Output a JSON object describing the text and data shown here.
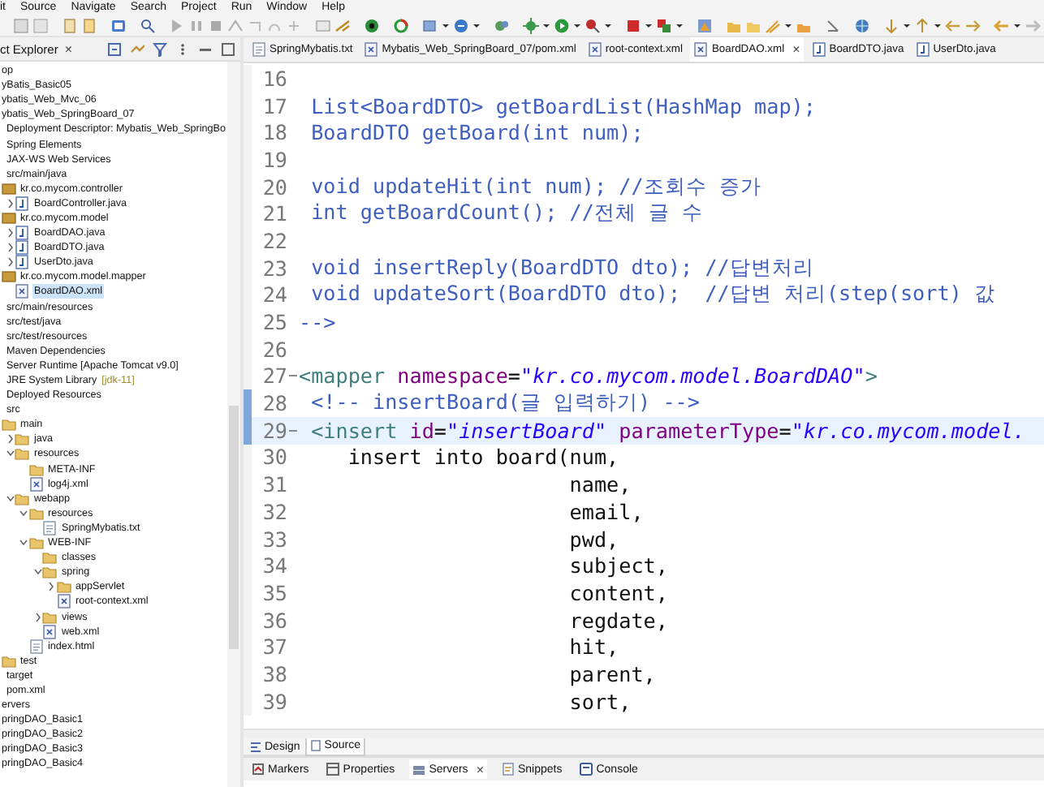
{
  "menu_bar": [
    "it",
    "Source",
    "Navigate",
    "Search",
    "Project",
    "Run",
    "Window",
    "Help"
  ],
  "explorer": {
    "title": "ct Explorer",
    "close": "×",
    "tree": [
      {
        "label": "op",
        "selected": false
      },
      {
        "label": "yBatis_Basic05",
        "selected": false
      },
      {
        "label": "ybatis_Web_Mvc_06",
        "selected": false
      },
      {
        "label": "ybatis_Web_SpringBoard_07",
        "selected": false,
        "children": [
          {
            "label": "Deployment Descriptor: Mybatis_Web_SpringBo",
            "selected": false
          },
          {
            "label": "Spring Elements",
            "selected": false
          },
          {
            "label": "JAX-WS Web Services",
            "selected": false
          },
          {
            "label": "src/main/java",
            "selected": false,
            "children": [
              {
                "label": "kr.co.mycom.controller",
                "kind": "package",
                "selected": false,
                "children": [
                  {
                    "label": "BoardController.java",
                    "kind": "java",
                    "expanded": false,
                    "selected": false
                  }
                ]
              },
              {
                "label": "kr.co.mycom.model",
                "kind": "package",
                "selected": false,
                "children": [
                  {
                    "label": "BoardDAO.java",
                    "kind": "java",
                    "expanded": false,
                    "selected": false
                  },
                  {
                    "label": "BoardDTO.java",
                    "kind": "java",
                    "expanded": false,
                    "selected": false
                  },
                  {
                    "label": "UserDto.java",
                    "kind": "java",
                    "expanded": false,
                    "selected": false
                  }
                ]
              },
              {
                "label": "kr.co.mycom.model.mapper",
                "kind": "package",
                "selected": false,
                "children": [
                  {
                    "label": "BoardDAO.xml",
                    "kind": "xml",
                    "selected": true
                  }
                ]
              }
            ]
          },
          {
            "label": "src/main/resources",
            "selected": false
          },
          {
            "label": "src/test/java",
            "selected": false
          },
          {
            "label": "src/test/resources",
            "selected": false
          },
          {
            "label": "Maven Dependencies",
            "selected": false
          },
          {
            "label": "Server Runtime [Apache Tomcat v9.0]",
            "selected": false
          },
          {
            "label": "JRE System Library",
            "decoration": "[jdk-11]",
            "selected": false
          },
          {
            "label": "Deployed Resources",
            "selected": false
          },
          {
            "label": "src",
            "selected": false,
            "children": [
              {
                "label": "main",
                "kind": "folder",
                "selected": false,
                "children": [
                  {
                    "label": "java",
                    "kind": "folder",
                    "expanded": false,
                    "selected": false
                  },
                  {
                    "label": "resources",
                    "kind": "folder",
                    "expanded": true,
                    "selected": false,
                    "children": [
                      {
                        "label": "META-INF",
                        "kind": "folder",
                        "selected": false
                      },
                      {
                        "label": "log4j.xml",
                        "kind": "xml",
                        "selected": false
                      }
                    ]
                  },
                  {
                    "label": "webapp",
                    "kind": "folder",
                    "expanded": true,
                    "selected": false,
                    "children": [
                      {
                        "label": "resources",
                        "kind": "folder",
                        "expanded": true,
                        "selected": false,
                        "children": [
                          {
                            "label": "SpringMybatis.txt",
                            "kind": "text",
                            "selected": false
                          }
                        ]
                      },
                      {
                        "label": "WEB-INF",
                        "kind": "folder",
                        "expanded": true,
                        "selected": false,
                        "children": [
                          {
                            "label": "classes",
                            "kind": "folder",
                            "selected": false
                          },
                          {
                            "label": "spring",
                            "kind": "folder",
                            "expanded": true,
                            "selected": false,
                            "children": [
                              {
                                "label": "appServlet",
                                "kind": "folder",
                                "expanded": false,
                                "selected": false
                              },
                              {
                                "label": "root-context.xml",
                                "kind": "xml",
                                "selected": false
                              }
                            ]
                          },
                          {
                            "label": "views",
                            "kind": "folder",
                            "expanded": false,
                            "selected": false
                          },
                          {
                            "label": "web.xml",
                            "kind": "xml",
                            "selected": false
                          }
                        ]
                      },
                      {
                        "label": "index.html",
                        "kind": "text",
                        "selected": false
                      }
                    ]
                  }
                ]
              },
              {
                "label": "test",
                "kind": "folder",
                "selected": false
              }
            ]
          },
          {
            "label": "target",
            "selected": false
          },
          {
            "label": "pom.xml",
            "selected": false
          }
        ]
      },
      {
        "label": "ervers",
        "selected": false
      },
      {
        "label": "pringDAO_Basic1",
        "selected": false
      },
      {
        "label": "pringDAO_Basic2",
        "selected": false
      },
      {
        "label": "pringDAO_Basic3",
        "selected": false
      },
      {
        "label": "pringDAO_Basic4",
        "selected": false
      }
    ]
  },
  "editor_tabs": [
    {
      "label": "SpringMybatis.txt",
      "kind": "text",
      "selected": false
    },
    {
      "label": "Mybatis_Web_SpringBoard_07/pom.xml",
      "kind": "xml",
      "selected": false
    },
    {
      "label": "root-context.xml",
      "kind": "xml",
      "selected": false
    },
    {
      "label": "BoardDAO.xml",
      "kind": "xml",
      "selected": true,
      "close": "×"
    },
    {
      "label": "BoardDTO.java",
      "kind": "java",
      "selected": false
    },
    {
      "label": "UserDto.java",
      "kind": "java",
      "selected": false
    }
  ],
  "editor": {
    "lines": [
      {
        "number": "16",
        "foldable": false,
        "current": false
      },
      {
        "number": "17",
        "foldable": false,
        "current": false,
        "segments": [
          {
            "text": " List<BoardDTO> getBoardList(HashMap map);",
            "kind": "comment"
          }
        ]
      },
      {
        "number": "18",
        "foldable": false,
        "current": false,
        "segments": [
          {
            "text": " BoardDTO getBoard(int num);",
            "kind": "comment"
          }
        ]
      },
      {
        "number": "19",
        "foldable": false,
        "current": false
      },
      {
        "number": "20",
        "foldable": false,
        "current": false,
        "segments": [
          {
            "text": " void updateHit(int num); //조회수 증가",
            "kind": "comment"
          }
        ]
      },
      {
        "number": "21",
        "foldable": false,
        "current": false,
        "segments": [
          {
            "text": " int getBoardCount(); //전체 글 수",
            "kind": "comment"
          }
        ]
      },
      {
        "number": "22",
        "foldable": false,
        "current": false
      },
      {
        "number": "23",
        "foldable": false,
        "current": false,
        "segments": [
          {
            "text": " void insertReply(BoardDTO dto); //답변처리",
            "kind": "comment"
          }
        ]
      },
      {
        "number": "24",
        "foldable": false,
        "current": false,
        "segments": [
          {
            "text": " void updateSort(BoardDTO dto);  //답변 처리(step(sort) 값",
            "kind": "comment"
          }
        ]
      },
      {
        "number": "25",
        "foldable": false,
        "current": false,
        "segments": [
          {
            "text": "-->",
            "kind": "comment"
          }
        ]
      },
      {
        "number": "26",
        "foldable": false,
        "current": false
      },
      {
        "number": "27",
        "foldable": true,
        "current": false,
        "segments": [
          {
            "text": "<mapper",
            "kind": "tag"
          },
          {
            "text": " namespace",
            "kind": "attr"
          },
          {
            "text": "=",
            "kind": "plain"
          },
          {
            "text": "\"kr.co.mycom.model.BoardDAO\"",
            "kind": "string"
          },
          {
            "text": ">",
            "kind": "tag"
          }
        ]
      },
      {
        "number": "28",
        "foldable": false,
        "current": false,
        "segments": [
          {
            "text": " <!-- insertBoard(글 입력하기) -->",
            "kind": "comment"
          }
        ]
      },
      {
        "number": "29",
        "foldable": true,
        "current": true,
        "segments": [
          {
            "text": " <insert",
            "kind": "tag"
          },
          {
            "text": " id",
            "kind": "attr"
          },
          {
            "text": "=",
            "kind": "plain"
          },
          {
            "text": "\"insertBoard\"",
            "kind": "string"
          },
          {
            "text": " parameterType",
            "kind": "attr"
          },
          {
            "text": "=",
            "kind": "plain"
          },
          {
            "text": "\"kr.co.mycom.model.",
            "kind": "string"
          }
        ]
      },
      {
        "number": "30",
        "foldable": false,
        "current": false,
        "segments": [
          {
            "text": "    insert into board(num,",
            "kind": "plain"
          }
        ]
      },
      {
        "number": "31",
        "foldable": false,
        "current": false,
        "segments": [
          {
            "text": "                      name,",
            "kind": "plain"
          }
        ]
      },
      {
        "number": "32",
        "foldable": false,
        "current": false,
        "segments": [
          {
            "text": "                      email,",
            "kind": "plain"
          }
        ]
      },
      {
        "number": "33",
        "foldable": false,
        "current": false,
        "segments": [
          {
            "text": "                      pwd,",
            "kind": "plain"
          }
        ]
      },
      {
        "number": "34",
        "foldable": false,
        "current": false,
        "segments": [
          {
            "text": "                      subject,",
            "kind": "plain"
          }
        ]
      },
      {
        "number": "35",
        "foldable": false,
        "current": false,
        "segments": [
          {
            "text": "                      content,",
            "kind": "plain"
          }
        ]
      },
      {
        "number": "36",
        "foldable": false,
        "current": false,
        "segments": [
          {
            "text": "                      regdate,",
            "kind": "plain"
          }
        ]
      },
      {
        "number": "37",
        "foldable": false,
        "current": false,
        "segments": [
          {
            "text": "                      hit,",
            "kind": "plain"
          }
        ]
      },
      {
        "number": "38",
        "foldable": false,
        "current": false,
        "segments": [
          {
            "text": "                      parent,",
            "kind": "plain"
          }
        ]
      },
      {
        "number": "39",
        "foldable": false,
        "current": false,
        "segments": [
          {
            "text": "                      sort,",
            "kind": "plain"
          }
        ]
      }
    ]
  },
  "editor_view_tabs": [
    {
      "label": "Design",
      "selected": false
    },
    {
      "label": "Source",
      "selected": true
    }
  ],
  "panel_tabs": [
    {
      "label": "Markers",
      "selected": false
    },
    {
      "label": "Properties",
      "selected": false
    },
    {
      "label": "Servers",
      "selected": true,
      "close": "×"
    },
    {
      "label": "Snippets",
      "selected": false
    },
    {
      "label": "Console",
      "selected": false
    }
  ]
}
